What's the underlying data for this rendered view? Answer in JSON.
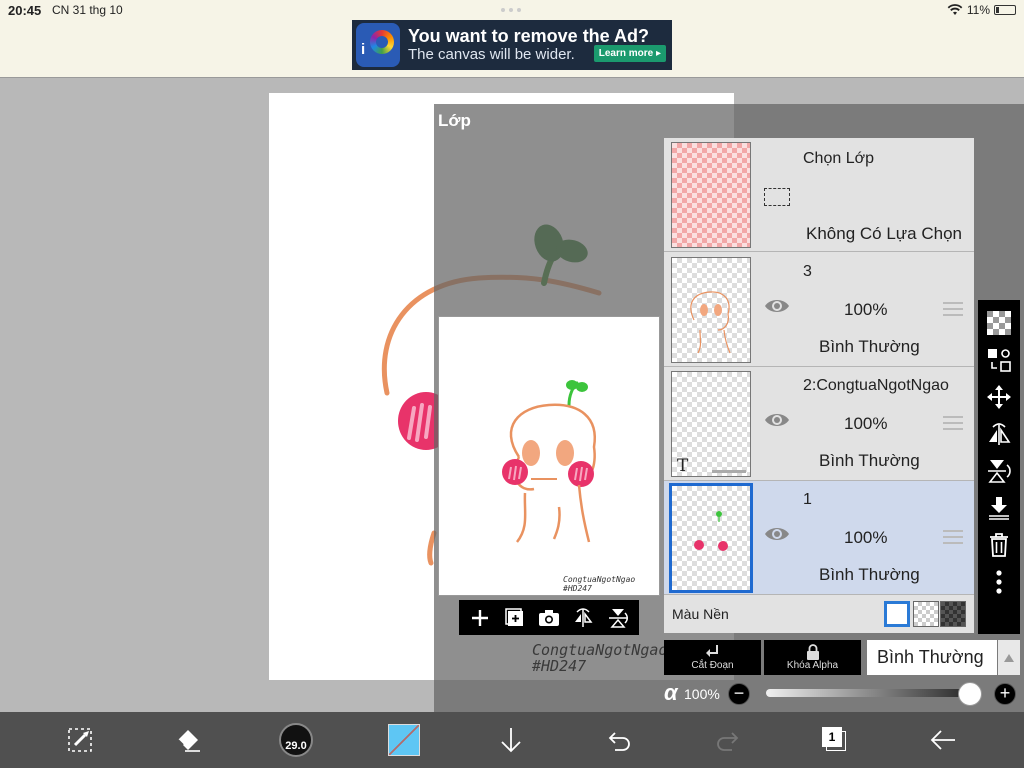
{
  "status_bar": {
    "time": "20:45",
    "date": "CN 31 thg 10",
    "battery": "11%"
  },
  "ad": {
    "title": "You want to remove the Ad?",
    "subtitle": "The canvas will be wider.",
    "cta": "Learn more ▸"
  },
  "layer_panel": {
    "title": "Lớp",
    "watermark": [
      "CongtuaNgotNgao",
      "#HD247"
    ],
    "preview_watermark": [
      "CongtuaNgotNgao",
      "#HD247"
    ],
    "selection": {
      "title": "Chọn Lớp",
      "status": "Không Có Lựa Chọn"
    },
    "layers": [
      {
        "name": "3",
        "opacity": "100%",
        "mode": "Bình Thường",
        "selected": false
      },
      {
        "name": "2:CongtuaNgotNgao",
        "opacity": "100%",
        "mode": "Bình Thường",
        "selected": false,
        "text_marker": "T"
      },
      {
        "name": "1",
        "opacity": "100%",
        "mode": "Bình Thường",
        "selected": true
      }
    ],
    "background": {
      "label": "Màu Nền"
    },
    "clip_label": "Cắt Đoạn",
    "alpha_lock_label": "Khóa Alpha",
    "blend_mode": "Bình Thường",
    "alpha": {
      "symbol": "α",
      "value": "100%"
    }
  },
  "bottom_bar": {
    "brush_size": "29.0",
    "page_number": "1"
  },
  "colors": {
    "selected_row": "#cfd9ec",
    "accent": "#1f6ad0",
    "stroke": "#e99260",
    "cheek": "#e8336a",
    "sprout": "#2f7a2f"
  }
}
